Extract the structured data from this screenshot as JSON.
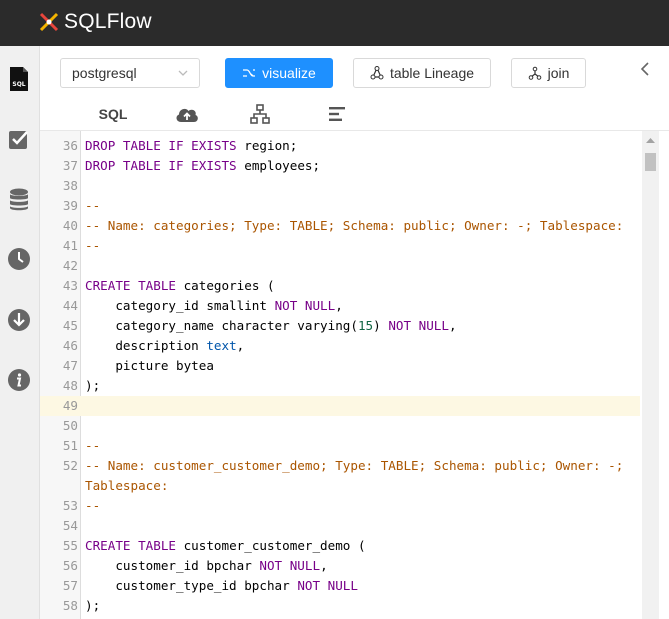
{
  "app": {
    "title": "SQLFlow"
  },
  "sidebar": {
    "items": [
      {
        "name": "sql-file-icon",
        "label": "SQL"
      },
      {
        "name": "checklist-icon"
      },
      {
        "name": "database-icon"
      },
      {
        "name": "clock-icon"
      },
      {
        "name": "download-icon"
      },
      {
        "name": "info-icon"
      }
    ]
  },
  "toolbar": {
    "dbvendor": "postgresql",
    "visualize_label": "visualize",
    "table_lineage_label": "table Lineage",
    "join_label": "join"
  },
  "tabs": {
    "sql_label": "SQL"
  },
  "colors": {
    "topbar": "#2b2b2b",
    "primary": "#1e90ff",
    "keyword": "#770088",
    "comment": "#aa5500",
    "number": "#116644",
    "type": "#0055aa",
    "active_line": "#fdf8e3"
  },
  "editor": {
    "active_line": "49",
    "lines": [
      {
        "n": "36",
        "tokens": [
          {
            "t": "DROP TABLE IF EXISTS",
            "c": "kw"
          },
          {
            "t": " region;"
          }
        ]
      },
      {
        "n": "37",
        "tokens": [
          {
            "t": "DROP TABLE IF EXISTS",
            "c": "kw"
          },
          {
            "t": " employees;"
          }
        ]
      },
      {
        "n": "38",
        "tokens": []
      },
      {
        "n": "39",
        "tokens": [
          {
            "t": "--",
            "c": "cm"
          }
        ]
      },
      {
        "n": "40",
        "tokens": [
          {
            "t": "-- Name: categories; Type: TABLE; Schema: public; Owner: -; Tablespace:",
            "c": "cm"
          }
        ]
      },
      {
        "n": "41",
        "tokens": [
          {
            "t": "--",
            "c": "cm"
          }
        ]
      },
      {
        "n": "42",
        "tokens": []
      },
      {
        "n": "43",
        "tokens": [
          {
            "t": "CREATE TABLE",
            "c": "kw"
          },
          {
            "t": " categories ("
          }
        ]
      },
      {
        "n": "44",
        "tokens": [
          {
            "t": "    category_id smallint "
          },
          {
            "t": "NOT NULL",
            "c": "kw"
          },
          {
            "t": ","
          }
        ]
      },
      {
        "n": "45",
        "tokens": [
          {
            "t": "    category_name character varying("
          },
          {
            "t": "15",
            "c": "num"
          },
          {
            "t": ") "
          },
          {
            "t": "NOT NULL",
            "c": "kw"
          },
          {
            "t": ","
          }
        ]
      },
      {
        "n": "46",
        "tokens": [
          {
            "t": "    description "
          },
          {
            "t": "text",
            "c": "ty"
          },
          {
            "t": ","
          }
        ]
      },
      {
        "n": "47",
        "tokens": [
          {
            "t": "    picture bytea"
          }
        ]
      },
      {
        "n": "48",
        "tokens": [
          {
            "t": ");"
          }
        ]
      },
      {
        "n": "49",
        "tokens": []
      },
      {
        "n": "50",
        "tokens": []
      },
      {
        "n": "51",
        "tokens": [
          {
            "t": "--",
            "c": "cm"
          }
        ]
      },
      {
        "n": "52",
        "tokens": [
          {
            "t": "-- Name: customer_customer_demo; Type: TABLE; Schema: public; Owner: -;",
            "c": "cm"
          }
        ]
      },
      {
        "n": "",
        "tokens": [
          {
            "t": "Tablespace:",
            "c": "cm"
          }
        ]
      },
      {
        "n": "53",
        "tokens": [
          {
            "t": "--",
            "c": "cm"
          }
        ]
      },
      {
        "n": "54",
        "tokens": []
      },
      {
        "n": "55",
        "tokens": [
          {
            "t": "CREATE TABLE",
            "c": "kw"
          },
          {
            "t": " customer_customer_demo ("
          }
        ]
      },
      {
        "n": "56",
        "tokens": [
          {
            "t": "    customer_id bpchar "
          },
          {
            "t": "NOT NULL",
            "c": "kw"
          },
          {
            "t": ","
          }
        ]
      },
      {
        "n": "57",
        "tokens": [
          {
            "t": "    customer_type_id bpchar "
          },
          {
            "t": "NOT NULL",
            "c": "kw"
          }
        ]
      },
      {
        "n": "58",
        "tokens": [
          {
            "t": ");"
          }
        ]
      }
    ]
  }
}
